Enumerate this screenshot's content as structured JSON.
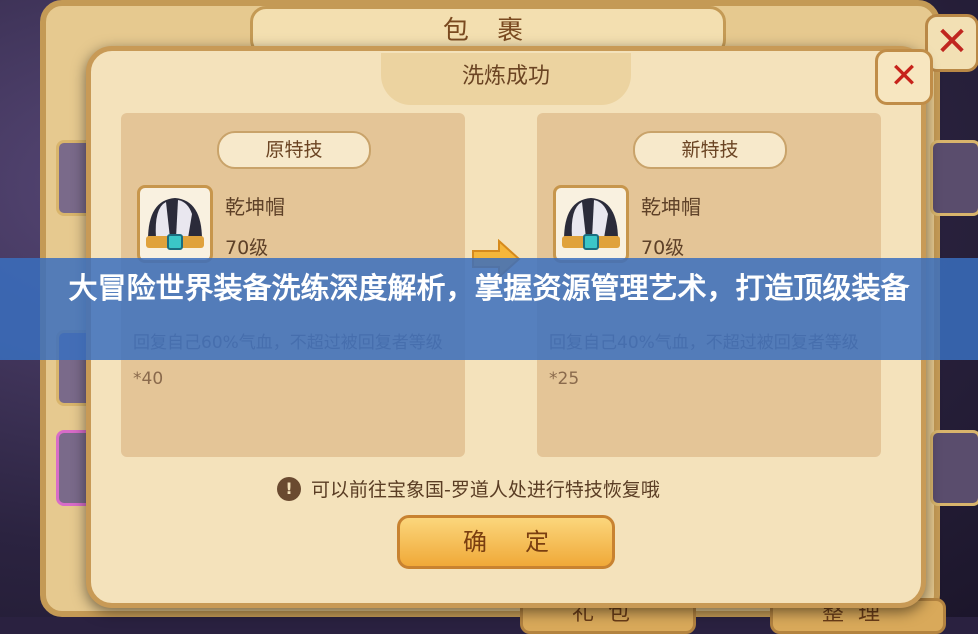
{
  "background": {
    "window_title": "包  裹",
    "bottom_tabs": [
      "礼包",
      "整理"
    ]
  },
  "dialog": {
    "title": "洗炼成功",
    "close_label": "✕",
    "old_skill": {
      "header": "原特技",
      "item_name": "乾坤帽",
      "item_level": "70级",
      "description": "回复自己60%气血，不超过被回复者等级*40"
    },
    "new_skill": {
      "header": "新特技",
      "item_name": "乾坤帽",
      "item_level": "70级",
      "description": "回复自己40%气血，不超过被回复者等级*25"
    },
    "tip_icon": "!",
    "tip_text": "可以前往宝象国-罗道人处进行特技恢复哦",
    "confirm_label": "确定"
  },
  "banner": {
    "text": "大冒险世界装备洗练深度解析，掌握资源管理艺术，打造顶级装备"
  },
  "colors": {
    "banner": "#3a6ebe",
    "dialog_bg": "#f4e2bb",
    "close_x": "#c7231b",
    "confirm_button": "#f0a938"
  }
}
